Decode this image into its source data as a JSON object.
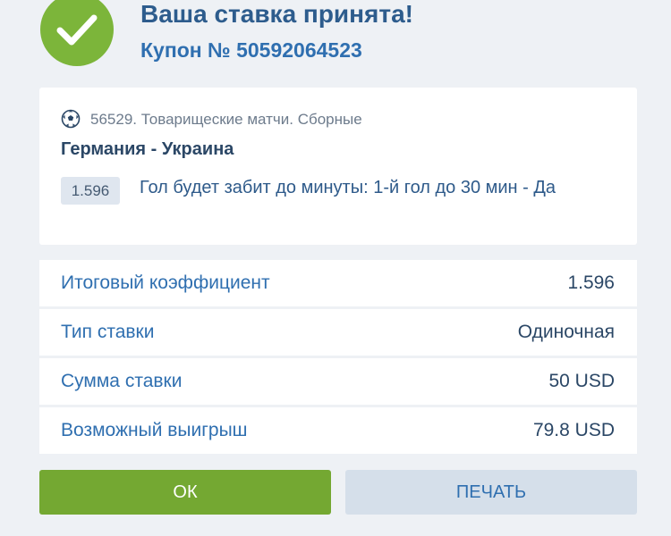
{
  "header": {
    "title": "Ваша ставка принята!",
    "coupon": "Купон № 50592064523"
  },
  "event": {
    "league": "56529. Товарищеские матчи. Сборные",
    "teams": "Германия - Украина",
    "odds": "1.596",
    "outcome": "Гол будет забит до минуты: 1-й гол до 30 мин - Да",
    "sport_icon": "soccer-ball-icon"
  },
  "summary": [
    {
      "label": "Итоговый коэффициент",
      "value": "1.596"
    },
    {
      "label": "Тип ставки",
      "value": "Одиночная"
    },
    {
      "label": "Сумма ставки",
      "value": "50 USD"
    },
    {
      "label": "Возможный выигрыш",
      "value": "79.8 USD"
    }
  ],
  "buttons": {
    "ok_label": "ОК",
    "print_label": "ПЕЧАТЬ"
  },
  "colors": {
    "success_green": "#7cb53a",
    "accent_blue": "#2f6fb0",
    "background": "#eef1f5"
  }
}
